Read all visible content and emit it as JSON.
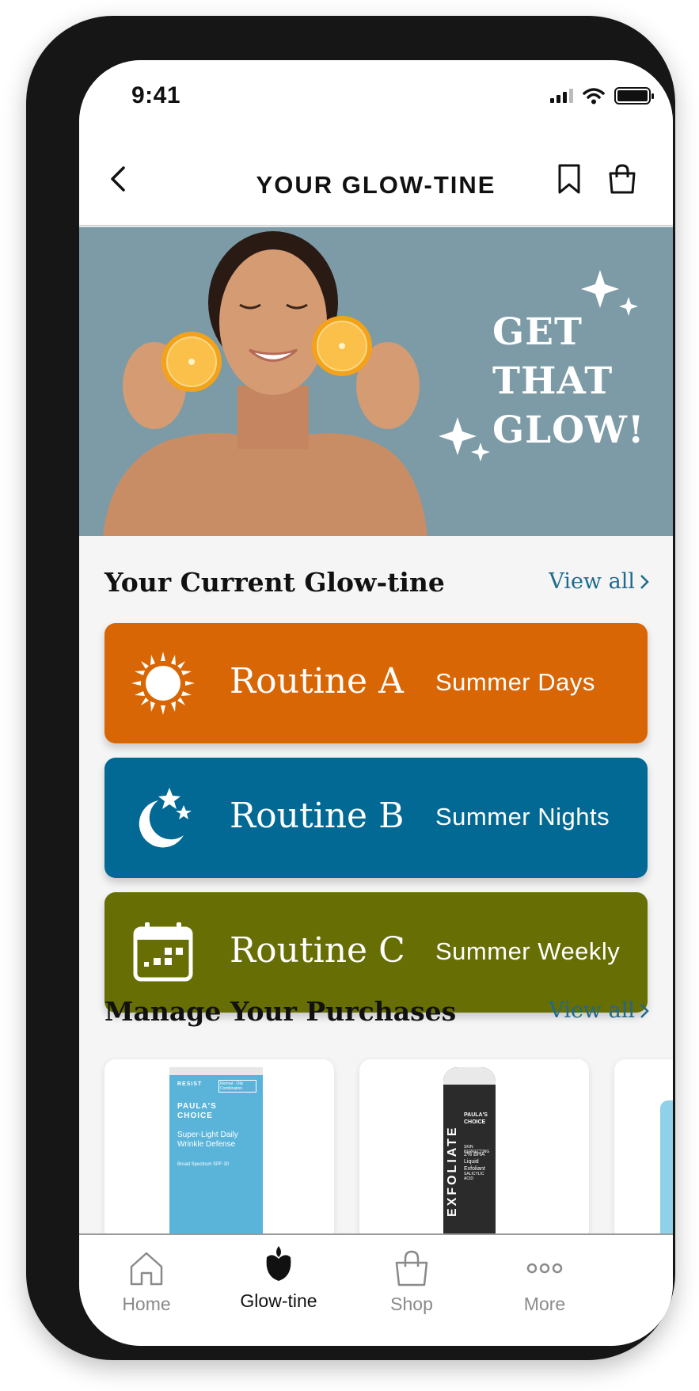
{
  "status_bar": {
    "time": "9:41"
  },
  "header": {
    "title": "YOUR GLOW-TINE"
  },
  "hero": {
    "line1": "GET",
    "line2": "THAT",
    "line3": "GLOW!"
  },
  "current": {
    "title": "Your Current Glow-tine",
    "view_all": "View all",
    "routines": [
      {
        "name": "Routine A",
        "subtitle": "Summer Days",
        "color": "#d86604",
        "icon": "sun-icon"
      },
      {
        "name": "Routine B",
        "subtitle": "Summer Nights",
        "color": "#026994",
        "icon": "moon-stars-icon"
      },
      {
        "name": "Routine C",
        "subtitle": "Summer Weekly",
        "color": "#676e03",
        "icon": "calendar-icon"
      }
    ]
  },
  "purchases": {
    "title": "Manage Your Purchases",
    "view_all": "View all",
    "products": [
      {
        "brand": "PAULA'S CHOICE",
        "line": "RESIST",
        "tag": "Normal - Oily Combination",
        "name": "Super-Light Daily Wrinkle Defense",
        "detail": "Broad Spectrum SPF 30",
        "color": "#5ab4d9"
      },
      {
        "brand": "PAULA'S CHOICE",
        "vertical": "EXFOLIATE",
        "tag": "SKIN PERFECTING",
        "name": "2% BHA Liquid Exfoliant",
        "detail": "SALICYLIC ACID",
        "color": "#2b2b2b"
      }
    ]
  },
  "tabbar": {
    "items": [
      {
        "label": "Home",
        "icon": "home-icon"
      },
      {
        "label": "Glow-tine",
        "icon": "glow-tine-icon",
        "active": true
      },
      {
        "label": "Shop",
        "icon": "shop-bag-icon"
      },
      {
        "label": "More",
        "icon": "more-icon"
      }
    ]
  }
}
